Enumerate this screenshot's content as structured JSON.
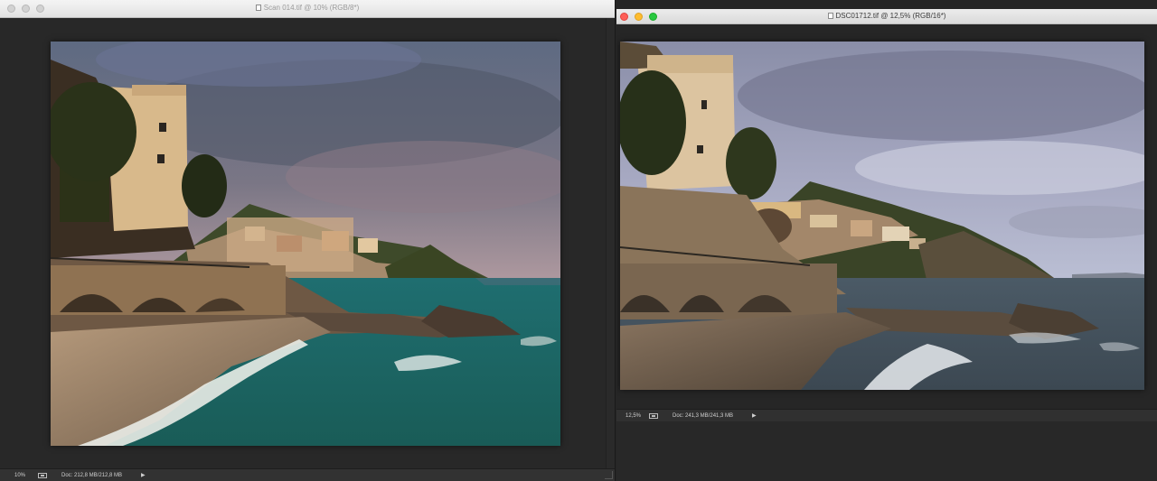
{
  "left_window": {
    "title": "Scan 014.tif @ 10% (RGB/8*)",
    "zoom": "10%",
    "doc_info": "Doc: 212,8 MB/212,8 MB",
    "active": false
  },
  "right_window": {
    "title": "DSC01712.tif @ 12,5% (RGB/16*)",
    "zoom": "12,5%",
    "doc_info": "Doc: 241,3 MB/241,3 MB",
    "active": true
  },
  "icons": {
    "status_menu": "triangle-right-icon",
    "proof": "proof-setup-icon",
    "document": "tif-document-icon"
  },
  "colors": {
    "workspace": "#262626",
    "statusbar": "#323232",
    "close": "#fe5f57",
    "minimize": "#febc2e",
    "maximize": "#28c840"
  }
}
